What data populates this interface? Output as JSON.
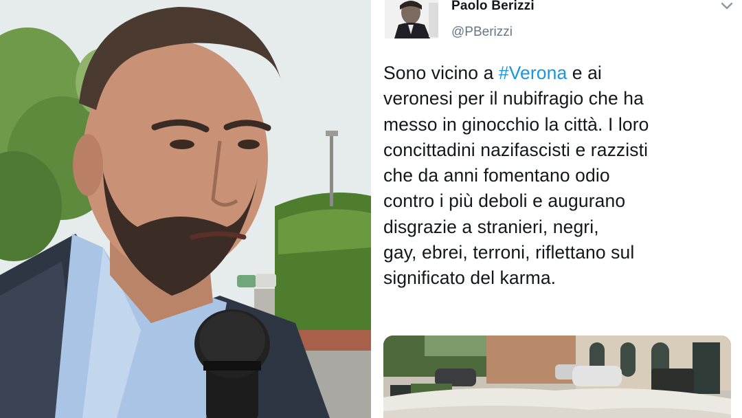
{
  "photo": {
    "subject": "man-portrait-with-microphone"
  },
  "tweet": {
    "author_name": "Paolo Berizzi",
    "author_handle": "@PBerizzi",
    "menu_icon": "chevron-down-icon",
    "hashtag_color": "#1b95e0",
    "lines": [
      {
        "before": "Sono vicino a ",
        "hashtag": "#Verona",
        "after": " e ai"
      },
      {
        "text": "veronesi per il nubifragio che ha"
      },
      {
        "text": "messo in ginocchio la città. I loro"
      },
      {
        "text": "concittadini nazifascisti e razzisti"
      },
      {
        "text": "che da anni fomentano odio"
      },
      {
        "text": "contro i più deboli e augurano"
      },
      {
        "text": "disgrazie a stranieri, negri,"
      },
      {
        "text": "gay, ebrei, terroni, riflettano sul"
      },
      {
        "text": "significato del karma."
      }
    ],
    "media": {
      "subject": "hail-covered-street-with-cars"
    }
  }
}
